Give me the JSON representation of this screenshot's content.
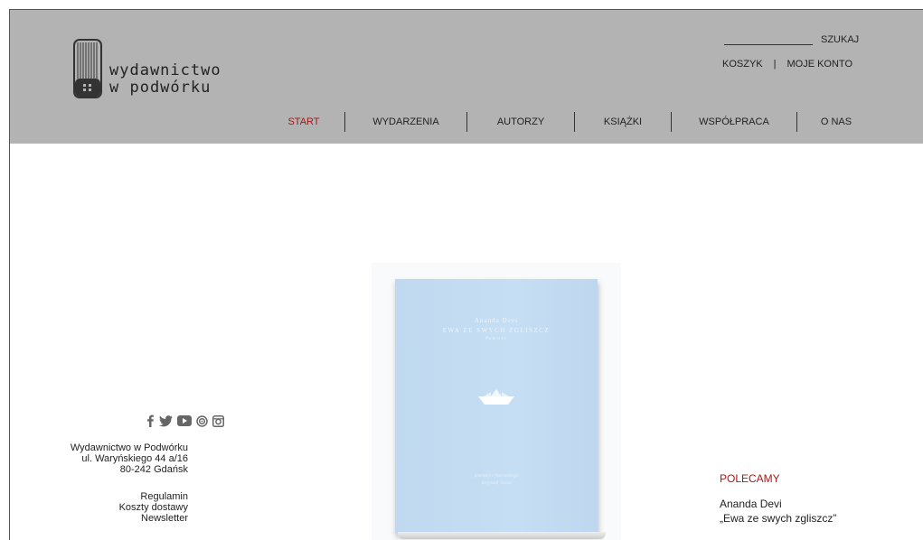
{
  "header": {
    "logo_line1": "wydawnictwo",
    "logo_line2": "w podwórku",
    "search_label": "SZUKAJ",
    "cart_label": "KOSZYK",
    "account_separator": "|",
    "account_label": "MOJE KONTO"
  },
  "nav": {
    "items": [
      {
        "label": "START",
        "active": true
      },
      {
        "label": "WYDARZENIA"
      },
      {
        "label": "AUTORZY"
      },
      {
        "label": "KSIĄŻKI"
      },
      {
        "label": "WSPÓŁPRACA"
      },
      {
        "label": "O NAS"
      }
    ]
  },
  "book": {
    "author": "Ananda Devi",
    "title": "EWA ZE SWYCH ZGLISZCZ",
    "subtitle": "Powieść",
    "credits_line1": "przełożył z francuskiego",
    "credits_line2": "Krzysztof Jarosz"
  },
  "footer": {
    "social_icons": [
      "facebook-icon",
      "twitter-icon",
      "youtube-icon",
      "issuu-icon",
      "instagram-icon"
    ],
    "address_line1": "Wydawnictwo w Podwórku",
    "address_line2": "ul. Waryńskiego 44 a/16",
    "address_line3": "80-242 Gdańsk",
    "link_terms": "Regulamin",
    "link_shipping": "Koszty dostawy",
    "link_newsletter": "Newsletter"
  },
  "recommended": {
    "heading": "POLECAMY",
    "author": "Ananda Devi",
    "title": "„Ewa ze swych zgliszcz”"
  },
  "colors": {
    "header_bg": "#b3b3b3",
    "accent": "#a31919",
    "book_cover": "#c4dcf2"
  }
}
